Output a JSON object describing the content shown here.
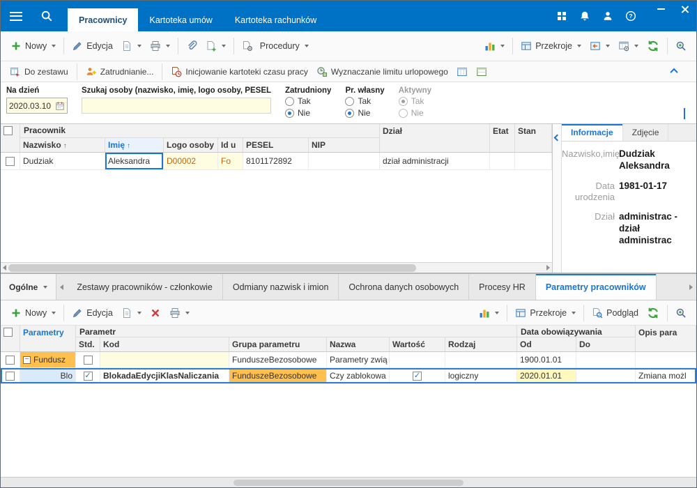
{
  "colors": {
    "titlebar_blue": "#0072C6",
    "accent_blue": "#1976D2",
    "group_orange": "#FFC04D",
    "edit_yellow": "#FFFDE1",
    "value_yellow": "#FFF9C0",
    "refresh_green": "#3AA43A"
  },
  "icons": [
    "hamburger-menu",
    "search",
    "apps-grid",
    "bell",
    "user",
    "help",
    "minimize",
    "close",
    "add-plus",
    "edit-pencil",
    "document",
    "printer",
    "paperclip",
    "procedures-document-gear",
    "bar-chart",
    "sections-layout",
    "window-arrow",
    "table-gear",
    "refresh",
    "search-plus",
    "calendar",
    "add-to-set-table",
    "hire-person-plus",
    "time-card-clock",
    "leave-limit-clock",
    "table-blue",
    "table-green",
    "delete-x",
    "preview-magnifier",
    "collapse-chevron",
    "sort-ascending",
    "checkbox",
    "radio"
  ],
  "titlebar": {
    "tabs": [
      {
        "label": "Pracownicy",
        "active": true
      },
      {
        "label": "Kartoteka umów",
        "active": false
      },
      {
        "label": "Kartoteka rachunków",
        "active": false
      }
    ]
  },
  "toolbar": {
    "nowy": "Nowy",
    "edycja": "Edycja",
    "procedury": "Procedury",
    "przekroje": "Przekroje"
  },
  "actionbar": {
    "do_zestawu": "Do zestawu",
    "zatrudnianie": "Zatrudnianie...",
    "inicjowanie": "Inicjowanie kartoteki czasu pracy",
    "wyznaczanie": "Wyznaczanie limitu urlopowego"
  },
  "filters": {
    "na_dzien": "Na dzień",
    "date_value": "2020.03.10",
    "szukaj_label": "Szukaj osoby (nazwisko, imię, logo osoby, PESEL)",
    "szukaj_value": "",
    "zatrudniony": "Zatrudniony",
    "pr_wlasny": "Pr. własny",
    "aktywny": "Aktywny",
    "tak": "Tak",
    "nie": "Nie",
    "zatrudniony_selected": "Nie",
    "pr_wlasny_selected": "Nie",
    "aktywny_selected": "Tak"
  },
  "grid": {
    "group_header": "Pracownik",
    "col_nazwisko": "Nazwisko",
    "col_imie": "Imię",
    "col_logo": "Logo osoby",
    "col_id": "Id u",
    "col_pesel": "PESEL",
    "col_nip": "NIP",
    "col_dzial": "Dział",
    "col_etat": "Etat",
    "col_stan": "Stan",
    "row": {
      "nazwisko": "Dudziak",
      "imie": "Aleksandra",
      "logo": "D00002",
      "id": "Fo",
      "pesel": "8101172892",
      "nip": "",
      "dzial": "dział administracji",
      "etat": "",
      "stan": ""
    }
  },
  "info_panel": {
    "tab_informacje": "Informacje",
    "tab_zdjecie": "Zdjęcie",
    "fields": [
      {
        "label": "Nazwisko,imię",
        "value": "Dudziak Aleksandra"
      },
      {
        "label": "Data urodzenia",
        "value": "1981-01-17"
      },
      {
        "label": "Dział",
        "value": "administrac - dział administrac"
      }
    ]
  },
  "bottom_tabs": {
    "ogolne": "Ogólne",
    "tabs": [
      {
        "label": "Zestawy pracowników - członkowie",
        "active": false
      },
      {
        "label": "Odmiany nazwisk i imion",
        "active": false
      },
      {
        "label": "Ochrona danych osobowych",
        "active": false
      },
      {
        "label": "Procesy HR",
        "active": false
      },
      {
        "label": "Parametry pracowników",
        "active": true
      }
    ]
  },
  "bottom_toolbar": {
    "nowy": "Nowy",
    "edycja": "Edycja",
    "przekroje": "Przekroje",
    "podglad": "Podgląd"
  },
  "param_grid": {
    "col_parametry": "Parametry",
    "group_parametr": "Parametr",
    "group_data": "Data obowiązywania",
    "col_std": "Std.",
    "col_kod": "Kod",
    "col_grupa": "Grupa parametru",
    "col_nazwa": "Nazwa",
    "col_wartosc": "Wartość",
    "col_rodzaj": "Rodzaj",
    "col_od": "Od",
    "col_do": "Do",
    "col_opis": "Opis para",
    "rows": [
      {
        "group_value": "Fundusz",
        "std": false,
        "kod": "",
        "grupa": "FunduszeBezosobowe",
        "nazwa": "Parametry zwią",
        "wartosc": false,
        "rodzaj": "",
        "od": "1900.01.01",
        "do": "",
        "opis": "",
        "selected": false
      },
      {
        "group_value": "Blo",
        "std": true,
        "kod": "BlokadaEdycjiKlasNaliczania",
        "grupa": "FunduszeBezosobowe",
        "nazwa": "Czy zablokowa",
        "wartosc": true,
        "rodzaj": "logiczny",
        "od": "2020.01.01",
        "do": "",
        "opis": "Zmiana możl",
        "selected": true
      }
    ]
  }
}
